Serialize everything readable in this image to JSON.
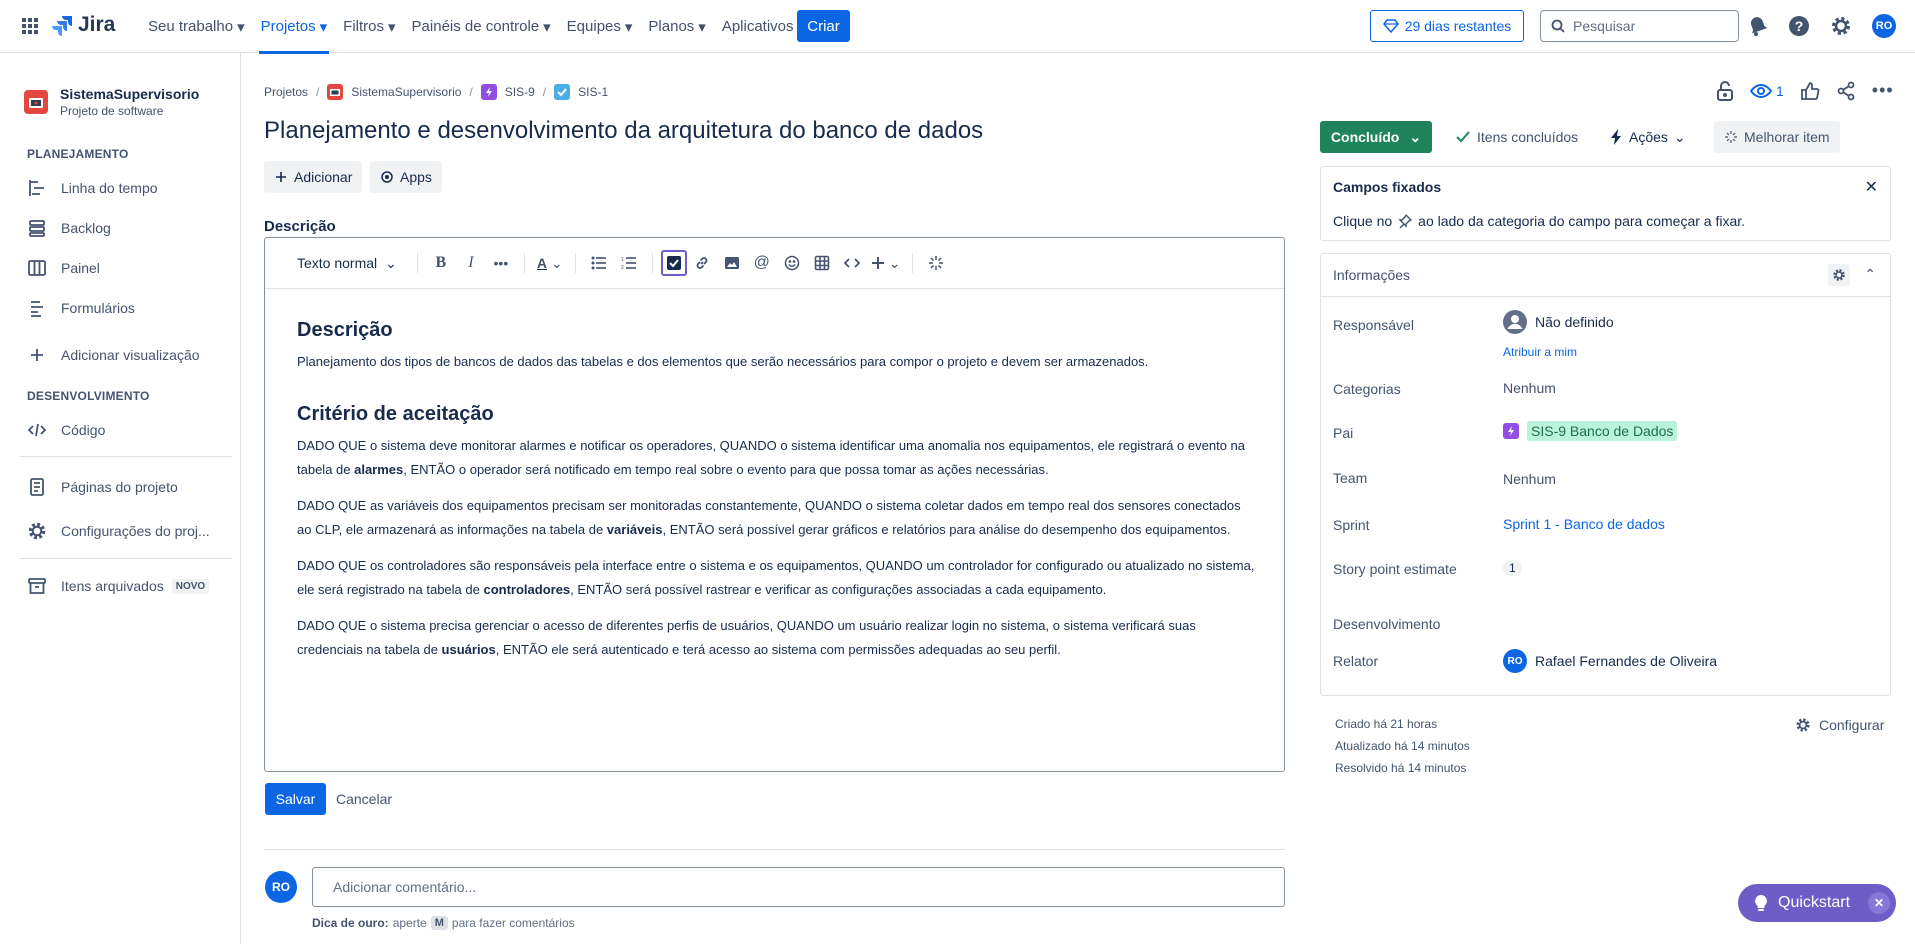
{
  "topnav": {
    "logo": "Jira",
    "items": [
      "Seu trabalho",
      "Projetos",
      "Filtros",
      "Painéis de controle",
      "Equipes",
      "Planos",
      "Aplicativos"
    ],
    "create": "Criar",
    "trial": "29 dias restantes",
    "search_placeholder": "Pesquisar",
    "user_initials": "RO"
  },
  "sidebar": {
    "project_name": "SistemaSupervisorio",
    "project_type": "Projeto de software",
    "section_planning": "PLANEJAMENTO",
    "planning_items": [
      "Linha do tempo",
      "Backlog",
      "Painel",
      "Formulários"
    ],
    "add_view": "Adicionar visualização",
    "section_dev": "DESENVOLVIMENTO",
    "dev_items": [
      "Código"
    ],
    "project_pages": "Páginas do projeto",
    "project_settings": "Configurações do proj...",
    "archived": "Itens arquivados",
    "new_badge": "NOVO"
  },
  "breadcrumbs": [
    "Projetos",
    "SistemaSupervisorio",
    "SIS-9",
    "SIS-1"
  ],
  "issue": {
    "title": "Planejamento e desenvolvimento da arquitetura do banco de dados",
    "add_label": "Adicionar",
    "apps_label": "Apps",
    "watchers": "1",
    "description_label": "Descrição"
  },
  "editor": {
    "text_style": "Texto normal",
    "heading1": "Descrição",
    "para1": "Planejamento dos tipos de bancos de dados das tabelas e dos elementos que serão necessários para compor o projeto e devem ser armazenados.",
    "heading2": "Critério de aceitação",
    "c1_a": "DADO QUE o sistema deve monitorar alarmes e notificar os operadores, QUANDO o sistema identificar uma anomalia nos equipamentos, ele registrará o evento na tabela de ",
    "c1_b": "alarmes",
    "c1_c": ", ENTÃO o operador será notificado em tempo real sobre o evento para que possa tomar as ações necessárias.",
    "c2_a": "DADO QUE as variáveis dos equipamentos precisam ser monitoradas constantemente, QUANDO o sistema coletar dados em tempo real dos sensores conectados ao CLP, ele armazenará as informações na tabela de ",
    "c2_b": "variáveis",
    "c2_c": ", ENTÃO será possível gerar gráficos e relatórios para análise do desempenho dos equipamentos.",
    "c3_a": "DADO QUE os controladores são responsáveis pela interface entre o sistema e os equipamentos, QUANDO um controlador for configurado ou atualizado no sistema, ele será registrado na tabela de ",
    "c3_b": "controladores",
    "c3_c": ", ENTÃO será possível rastrear e verificar as configurações associadas a cada equipamento.",
    "c4_a": "DADO QUE o sistema precisa gerenciar o acesso de diferentes perfis de usuários, QUANDO um usuário realizar login no sistema, o sistema verificará suas credenciais na tabela de ",
    "c4_b": "usuários",
    "c4_c": ", ENTÃO ele será autenticado e terá acesso ao sistema com permissões adequadas ao seu perfil.",
    "save": "Salvar",
    "cancel": "Cancelar"
  },
  "comment": {
    "placeholder": "Adicionar comentário...",
    "tip_bold": "Dica de ouro:",
    "tip_pre": "aperte",
    "tip_key": "M",
    "tip_post": "para fazer comentários"
  },
  "right": {
    "status": "Concluído",
    "done_items": "Itens concluídos",
    "actions": "Ações",
    "improve": "Melhorar item",
    "pinned_title": "Campos fixados",
    "pinned_pre": "Clique no",
    "pinned_post": "ao lado da categoria do campo para começar a fixar.",
    "info_title": "Informações",
    "fields": {
      "assignee_label": "Responsável",
      "assignee_value": "Não definido",
      "assign_me": "Atribuir a mim",
      "categories_label": "Categorias",
      "categories_value": "Nenhum",
      "parent_label": "Pai",
      "parent_value": "SIS-9 Banco de Dados",
      "team_label": "Team",
      "team_value": "Nenhum",
      "sprint_label": "Sprint",
      "sprint_value": "Sprint 1 - Banco de dados",
      "story_label": "Story point estimate",
      "story_value": "1",
      "dev_label": "Desenvolvimento",
      "reporter_label": "Relator",
      "reporter_value": "Rafael Fernandes de Oliveira"
    },
    "created": "Criado há 21 horas",
    "updated": "Atualizado há 14 minutos",
    "resolved": "Resolvido há 14 minutos",
    "configure": "Configurar"
  },
  "quickstart": "Quickstart",
  "colors": {
    "brand": "#0c66e4",
    "done": "#1f845a",
    "parent_tag": "#baf3db",
    "quickstart": "#6e5dc6",
    "project_icon": "#e2483d"
  }
}
